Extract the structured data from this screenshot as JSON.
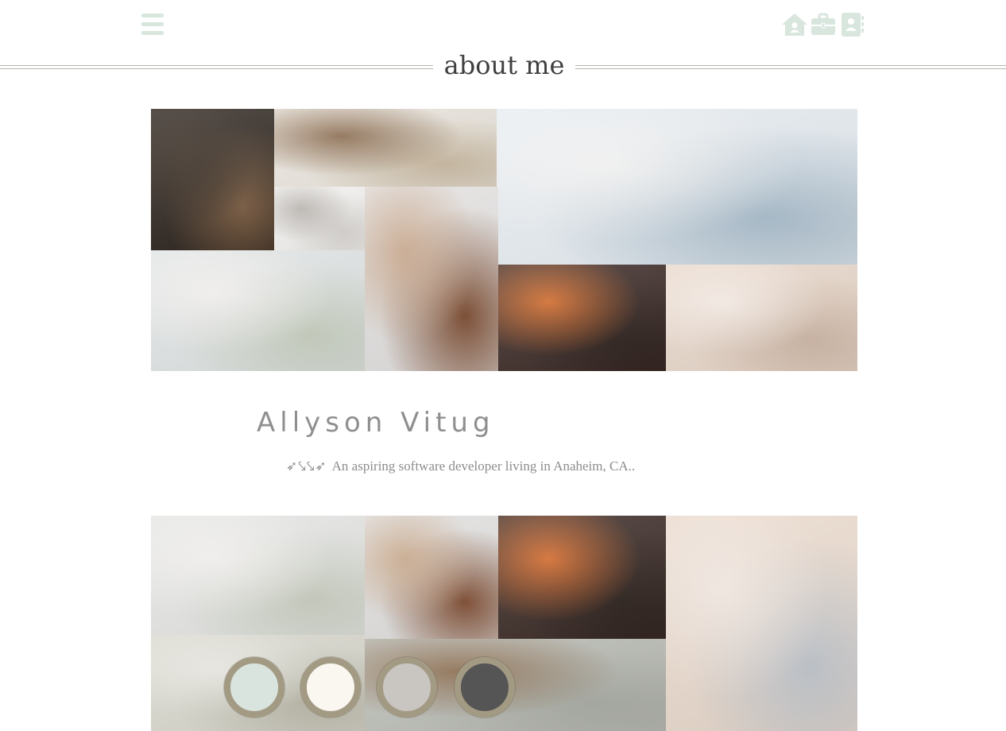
{
  "nav": {
    "menu_icon": "hamburger-menu-icon",
    "icons": [
      {
        "name": "home-icon"
      },
      {
        "name": "briefcase-icon"
      },
      {
        "name": "contact-book-icon"
      }
    ],
    "icon_color": "#d8e6de"
  },
  "heading": {
    "title": "about me"
  },
  "profile": {
    "name": "Allyson Vitug",
    "bio_prefix": "➶⤥⤥➶",
    "bio": "An aspiring software developer living in Anaheim, CA.."
  },
  "palette": {
    "ring_color": "#a39a84",
    "swatches": [
      "#d9e4df",
      "#faf7f1",
      "#c9c6c2",
      "#555555"
    ]
  },
  "collage_top": {
    "tiles": [
      {
        "name": "glass-building-photo",
        "colors": [
          "#2e2620",
          "#7a5b40",
          "#3c3026"
        ]
      },
      {
        "name": "notes-card-photo",
        "colors": [
          "#e9e4dc",
          "#c9b9a0",
          "#8a6b4e"
        ]
      },
      {
        "name": "cassette-tape-photo",
        "colors": [
          "#f2f0ee",
          "#d6d3cf",
          "#b9b5b0"
        ]
      },
      {
        "name": "white-fabric-jewelry-photo",
        "colors": [
          "#e5ebf0",
          "#a9bdcc",
          "#f4f4f4"
        ]
      },
      {
        "name": "babys-breath-flowers-photo",
        "colors": [
          "#dfe3e3",
          "#c7cfbf",
          "#f3f1ef"
        ]
      },
      {
        "name": "postcards-photo",
        "colors": [
          "#e2e0df",
          "#7b4a2f",
          "#c8a68a"
        ]
      },
      {
        "name": "rainbow-light-photo",
        "colors": [
          "#3b2a26",
          "#2c201c",
          "#d46b2a"
        ]
      },
      {
        "name": "ring-box-photo",
        "colors": [
          "#e7d6c9",
          "#cdb6a5",
          "#f5ebe4"
        ]
      }
    ]
  },
  "collage_bottom": {
    "tiles": [
      {
        "name": "babys-breath-flowers-photo",
        "colors": [
          "#e4e5e3",
          "#c9cec0",
          "#f3f1ef"
        ]
      },
      {
        "name": "postcards-photo",
        "colors": [
          "#e0dfde",
          "#7e4b30",
          "#c9a88a"
        ]
      },
      {
        "name": "rainbow-light-photo",
        "colors": [
          "#3a2a25",
          "#2b201c",
          "#d66a2a"
        ]
      },
      {
        "name": "ring-box-photo",
        "colors": [
          "#e9d9cc",
          "#bfc5cc",
          "#f2e8e1"
        ]
      },
      {
        "name": "open-book-photo",
        "colors": [
          "#d7d6cc",
          "#b8b6a6",
          "#e9e8e2"
        ]
      },
      {
        "name": "dried-flowers-photo",
        "colors": [
          "#b8bab3",
          "#a7aaa2",
          "#8b6c4e"
        ]
      }
    ]
  }
}
